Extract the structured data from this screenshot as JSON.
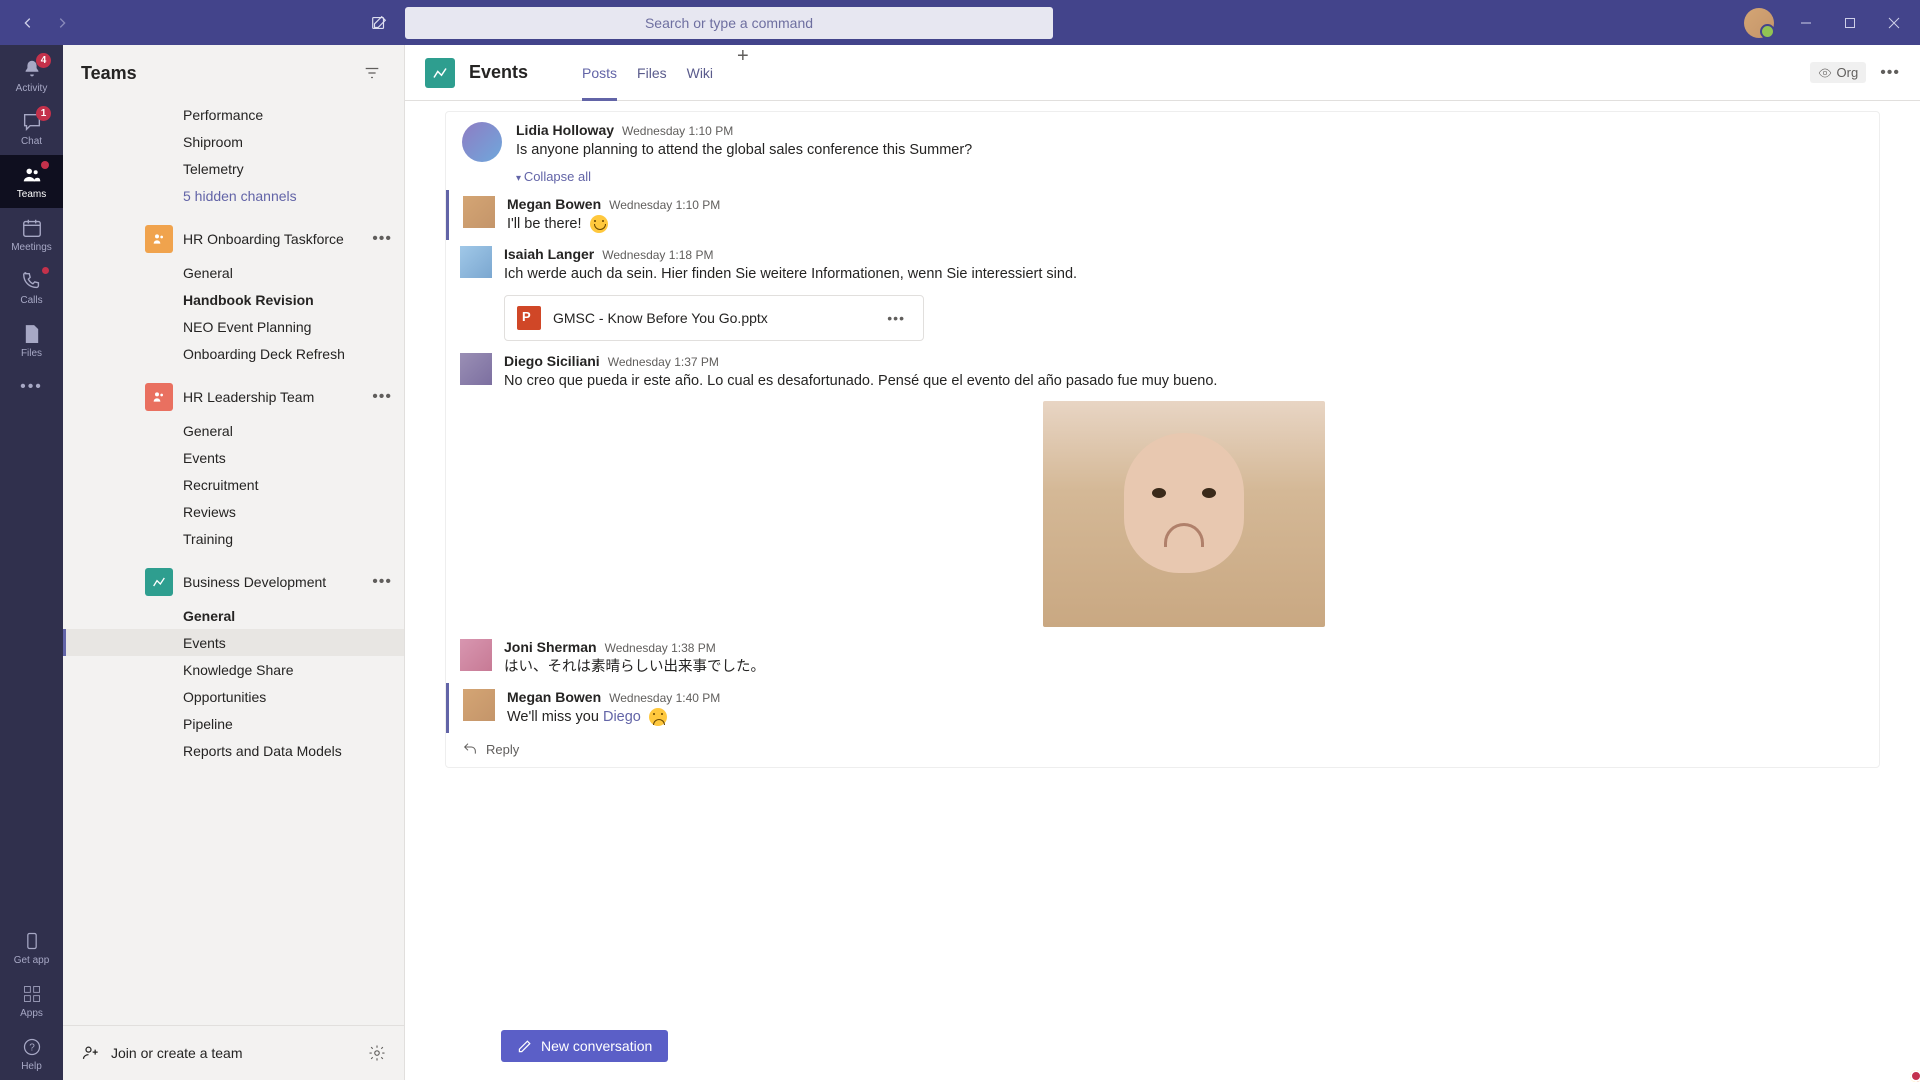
{
  "search": {
    "placeholder": "Search or type a command"
  },
  "rail": {
    "items": [
      {
        "label": "Activity",
        "badge": "4"
      },
      {
        "label": "Chat",
        "badge": "1"
      },
      {
        "label": "Teams"
      },
      {
        "label": "Meetings"
      },
      {
        "label": "Calls"
      },
      {
        "label": "Files"
      }
    ],
    "bottom": [
      {
        "label": "Get app"
      },
      {
        "label": "Apps"
      },
      {
        "label": "Help"
      }
    ]
  },
  "sidebar": {
    "title": "Teams",
    "orphan_channels": [
      "Performance",
      "Shiproom",
      "Telemetry"
    ],
    "hidden_link": "5 hidden channels",
    "teams": [
      {
        "name": "HR Onboarding Taskforce",
        "icon_color": "orange",
        "channels": [
          {
            "name": "General"
          },
          {
            "name": "Handbook Revision",
            "bold": true
          },
          {
            "name": "NEO Event Planning"
          },
          {
            "name": "Onboarding Deck Refresh"
          }
        ]
      },
      {
        "name": "HR Leadership Team",
        "icon_color": "red",
        "channels": [
          {
            "name": "General"
          },
          {
            "name": "Events"
          },
          {
            "name": "Recruitment"
          },
          {
            "name": "Reviews"
          },
          {
            "name": "Training"
          }
        ]
      },
      {
        "name": "Business Development",
        "icon_color": "teal",
        "channels": [
          {
            "name": "General",
            "bold": true
          },
          {
            "name": "Events",
            "selected": true
          },
          {
            "name": "Knowledge Share"
          },
          {
            "name": "Opportunities"
          },
          {
            "name": "Pipeline"
          },
          {
            "name": "Reports and Data Models"
          }
        ]
      }
    ],
    "join_label": "Join or create a team"
  },
  "header": {
    "channel": "Events",
    "tabs": [
      "Posts",
      "Files",
      "Wiki"
    ],
    "org_label": "Org"
  },
  "thread": {
    "root": {
      "author": "Lidia Holloway",
      "time": "Wednesday 1:10 PM",
      "text": "Is anyone planning to attend the global sales conference this Summer?"
    },
    "collapse_label": "Collapse all",
    "replies": [
      {
        "author": "Megan Bowen",
        "time": "Wednesday 1:10 PM",
        "text": "I'll be there!",
        "emoji": "smile",
        "presence": "busy"
      },
      {
        "author": "Isaiah Langer",
        "time": "Wednesday 1:18 PM",
        "text": "Ich werde auch da sein.  Hier finden Sie weitere Informationen, wenn Sie interessiert sind.",
        "attachment": "GMSC - Know Before You Go.pptx",
        "presence": "away"
      },
      {
        "author": "Diego Siciliani",
        "time": "Wednesday 1:37 PM",
        "text": "No creo que pueda ir este año. Lo cual es desafortunado. Pensé que el evento del año pasado fue muy bueno.",
        "gif": true,
        "presence": "oof"
      },
      {
        "author": "Joni Sherman",
        "time": "Wednesday 1:38 PM",
        "text": "はい、それは素晴らしい出来事でした。",
        "presence": "away"
      },
      {
        "author": "Megan Bowen",
        "time": "Wednesday 1:40 PM",
        "text_pre": "We'll miss you ",
        "mention": "Diego",
        "emoji": "sad",
        "presence": "busy"
      }
    ],
    "reply_label": "Reply"
  },
  "compose": {
    "new_conversation": "New conversation"
  }
}
